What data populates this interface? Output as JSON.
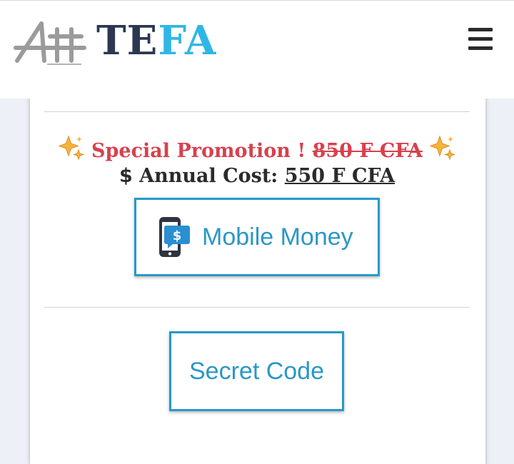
{
  "header": {
    "logo_text": "Att",
    "brand_part1": "TE",
    "brand_part2": "FA",
    "menu_icon": "hamburger-menu-icon"
  },
  "promo": {
    "sparkle_icon": "sparkles-icon",
    "title": "Special Promotion !",
    "old_price": "850 F CFA",
    "cost_symbol": "$",
    "cost_label": "Annual Cost:",
    "price": "550 F CFA"
  },
  "payment": {
    "mobile_money_icon": "mobile-payment-icon",
    "mobile_money_label": "Mobile Money",
    "secret_code_label": "Secret Code"
  },
  "colors": {
    "brand_dark": "#2c3850",
    "brand_light": "#2fb6e6",
    "promo_red": "#d9404d",
    "button_blue": "#2699c9",
    "sparkle_gold": "#f4b63a"
  }
}
